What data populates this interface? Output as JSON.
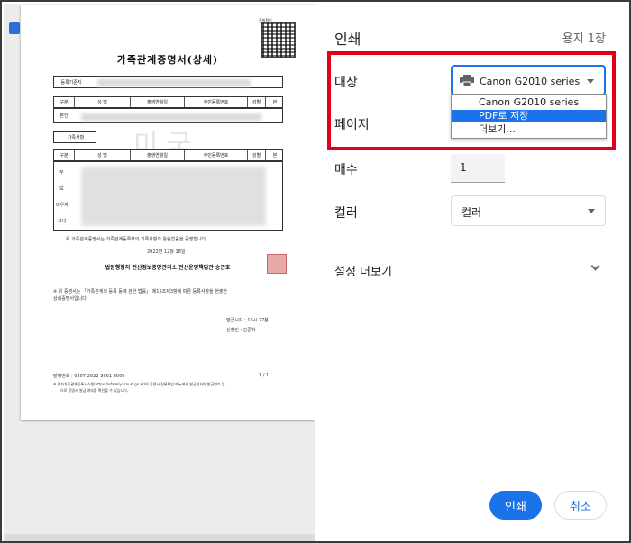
{
  "dialog": {
    "title": "인쇄",
    "sheet_count": "용지 1장",
    "destination_label": "대상",
    "destination_value": "Canon G2010 series",
    "destination_options": [
      "Canon G2010 series",
      "PDF로 저장",
      "더보기..."
    ],
    "selected_option_index": 1,
    "pages_label": "페이지",
    "copies_label": "매수",
    "copies_value": "1",
    "color_label": "컬러",
    "color_value": "컬러",
    "more_settings": "설정 더보기",
    "print_button": "인쇄",
    "cancel_button": "취소",
    "accent_color": "#1a73e8",
    "highlight_color": "#e0001b"
  },
  "preview": {
    "doc_title": "가족관계증명서(상세)",
    "head_label": "등록기준지",
    "col_headers": [
      "구분",
      "성 명",
      "출생연월일",
      "주민등록번호",
      "성별",
      "본"
    ],
    "principal_label": "본인",
    "family_label": "가족사항",
    "family_rows": [
      "부",
      "모",
      "배우자",
      "자녀"
    ],
    "statement": "위 가족관계증명서는 가족관계등록부의 기록사항과 틀림없음을 증명합니다.",
    "date": "2022년 12월 18일",
    "issuer": "법원행정처 전산정보중앙관리소 전산운영책임관 송관호",
    "note_line1": "※ 위 증명서는 「가족관계의 등록 등에 관한 법률」 제15조제3항에 따른 등록사항을 현출한",
    "note_line2": "상세증명서입니다.",
    "issue_time": "발급시각 : 16시 27분",
    "applicant": "신청인 : 김준하",
    "issue_no": "발행번호 : 0207-2022-3001-3000",
    "page_indicator": "1 / 1",
    "footer_note": "※ 전자가족관계등록시스템(https://efamily.scourt.go.kr)의 증명서 진위확인 메뉴에서 발급일자와 발급번호 등",
    "footer_note2": "으로 증명서 발급 여부를 확인할 수 있습니다.",
    "qr_label": "진위확인",
    "watermark": "미 국",
    "bottom_text": "—"
  }
}
